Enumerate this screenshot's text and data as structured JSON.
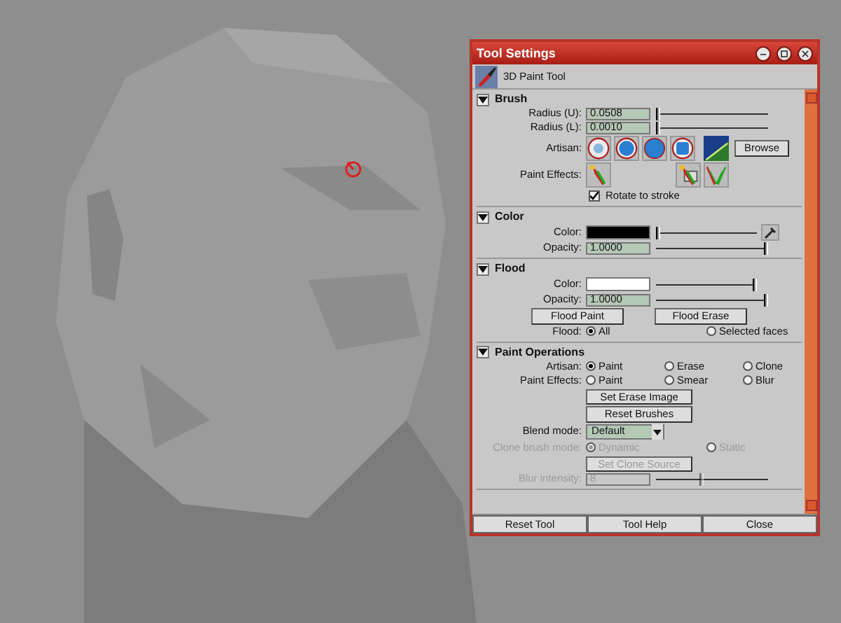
{
  "viewport": {
    "kind": "picture"
  },
  "window": {
    "title": "Tool Settings",
    "tool_name": "3D Paint Tool"
  },
  "sections": [
    {
      "title": "Brush",
      "expanded": true,
      "rows": [
        {
          "kind": "field_slider",
          "label": "Radius (U):",
          "value": "0.0508",
          "level": 0.0
        },
        {
          "kind": "field_slider",
          "label": "Radius (L):",
          "value": "0.0010",
          "level": 0.0
        },
        {
          "kind": "artisan_icons",
          "label": "Artisan:",
          "button": "Browse"
        },
        {
          "kind": "effects_icons",
          "label": "Paint Effects:"
        },
        {
          "kind": "checkbox",
          "label": "Rotate to stroke",
          "checked": true
        }
      ]
    },
    {
      "title": "Color",
      "expanded": true,
      "rows": [
        {
          "kind": "swatch_slider",
          "label": "Color:",
          "color": "#000000",
          "level": 0.0,
          "picker": true
        },
        {
          "kind": "field_slider",
          "label": "Opacity:",
          "value": "1.0000",
          "level": 1.0
        }
      ]
    },
    {
      "title": "Flood",
      "expanded": true,
      "rows": [
        {
          "kind": "swatch_slider",
          "label": "Color:",
          "color": "#ffffff",
          "level": 1.0,
          "picker": false
        },
        {
          "kind": "field_slider",
          "label": "Opacity:",
          "value": "1.0000",
          "level": 1.0
        },
        {
          "kind": "buttons",
          "buttons": [
            {
              "label": "Flood Paint",
              "disabled": false
            },
            {
              "label": "Flood Erase",
              "disabled": false
            }
          ]
        },
        {
          "kind": "radios",
          "label": "Flood:",
          "disabled": false,
          "options": [
            {
              "label": "All",
              "selected": true
            },
            {
              "label": "Selected faces",
              "selected": false
            }
          ]
        }
      ]
    },
    {
      "title": "Paint Operations",
      "expanded": true,
      "rows": [
        {
          "kind": "radios",
          "label": "Artisan:",
          "disabled": false,
          "options": [
            {
              "label": "Paint",
              "selected": true
            },
            {
              "label": "Erase",
              "selected": false
            },
            {
              "label": "Clone",
              "selected": false
            }
          ]
        },
        {
          "kind": "radios",
          "label": "Paint Effects:",
          "disabled": false,
          "options": [
            {
              "label": "Paint",
              "selected": false
            },
            {
              "label": "Smear",
              "selected": false
            },
            {
              "label": "Blur",
              "selected": false
            }
          ]
        },
        {
          "kind": "buttons",
          "buttons": [
            {
              "label": "Set Erase Image",
              "disabled": false
            }
          ]
        },
        {
          "kind": "buttons",
          "buttons": [
            {
              "label": "Reset Brushes",
              "disabled": false
            }
          ]
        },
        {
          "kind": "dropdown",
          "label": "Blend mode:",
          "value": "Default"
        },
        {
          "kind": "radios",
          "label": "Clone brush mode:",
          "disabled": true,
          "options": [
            {
              "label": "Dynamic",
              "selected": true
            },
            {
              "label": "Static",
              "selected": false
            }
          ]
        },
        {
          "kind": "buttons",
          "buttons": [
            {
              "label": "Set Clone Source",
              "disabled": true
            }
          ]
        },
        {
          "kind": "field_slider",
          "label": "Blur intensity:",
          "value": "8",
          "level": 0.4,
          "disabled": true
        }
      ]
    }
  ],
  "footer": [
    "Reset Tool",
    "Tool Help",
    "Close"
  ]
}
